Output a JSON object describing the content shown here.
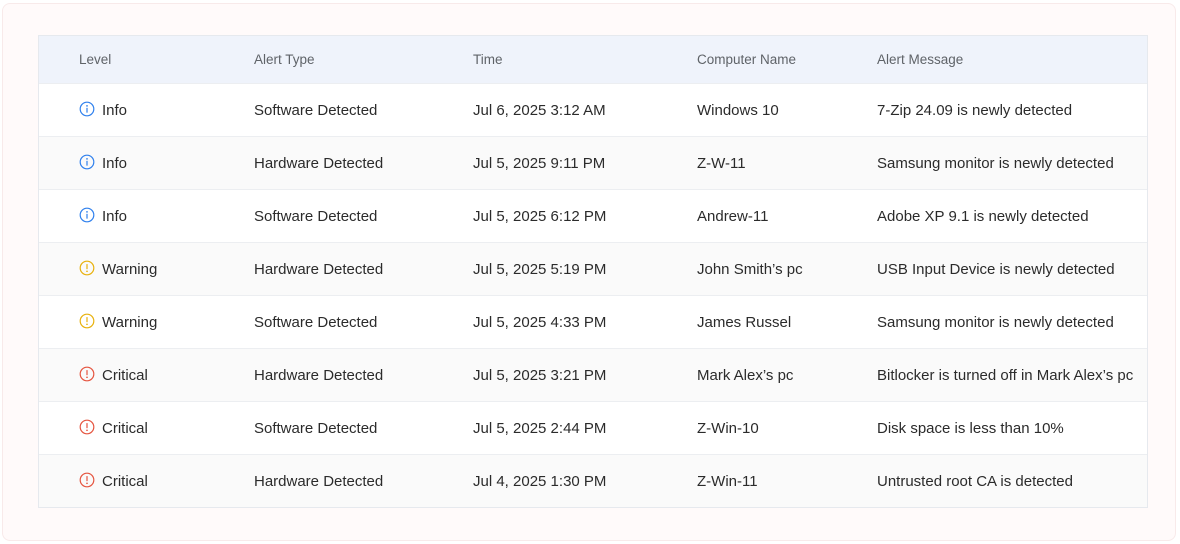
{
  "colors": {
    "info": "#2f80ed",
    "warning": "#e8b10c",
    "critical": "#e5543f",
    "header_bg": "#eff3fb"
  },
  "columns": {
    "level": "Level",
    "alert_type": "Alert Type",
    "time": "Time",
    "computer_name": "Computer Name",
    "alert_message": "Alert Message"
  },
  "rows": [
    {
      "level": "Info",
      "level_icon": "info-icon",
      "alert_type": "Software Detected",
      "time": "Jul 6, 2025 3:12 AM",
      "computer_name": "Windows 10",
      "alert_message": "7-Zip 24.09 is newly detected"
    },
    {
      "level": "Info",
      "level_icon": "info-icon",
      "alert_type": "Hardware Detected",
      "time": "Jul 5, 2025 9:11 PM",
      "computer_name": "Z-W-11",
      "alert_message": "Samsung monitor is newly detected"
    },
    {
      "level": "Info",
      "level_icon": "info-icon",
      "alert_type": "Software Detected",
      "time": "Jul 5, 2025 6:12 PM",
      "computer_name": "Andrew-11",
      "alert_message": "Adobe XP 9.1  is newly detected"
    },
    {
      "level": "Warning",
      "level_icon": "warning-icon",
      "alert_type": "Hardware Detected",
      "time": "Jul 5, 2025 5:19 PM",
      "computer_name": "John Smith’s pc",
      "alert_message": "USB Input Device is newly detected"
    },
    {
      "level": "Warning",
      "level_icon": "warning-icon",
      "alert_type": "Software Detected",
      "time": "Jul 5, 2025 4:33 PM",
      "computer_name": "James Russel",
      "alert_message": "Samsung monitor is newly detected"
    },
    {
      "level": "Critical",
      "level_icon": "critical-icon",
      "alert_type": "Hardware Detected",
      "time": "Jul 5, 2025 3:21 PM",
      "computer_name": "Mark Alex’s pc",
      "alert_message": "Bitlocker is turned off in Mark Alex’s pc"
    },
    {
      "level": "Critical",
      "level_icon": "critical-icon",
      "alert_type": "Software Detected",
      "time": "Jul 5, 2025 2:44 PM",
      "computer_name": "Z-Win-10",
      "alert_message": "Disk space is less than 10%"
    },
    {
      "level": "Critical",
      "level_icon": "critical-icon",
      "alert_type": "Hardware Detected",
      "time": "Jul 4, 2025 1:30 PM",
      "computer_name": "Z-Win-11",
      "alert_message": "Untrusted root CA is detected"
    }
  ]
}
